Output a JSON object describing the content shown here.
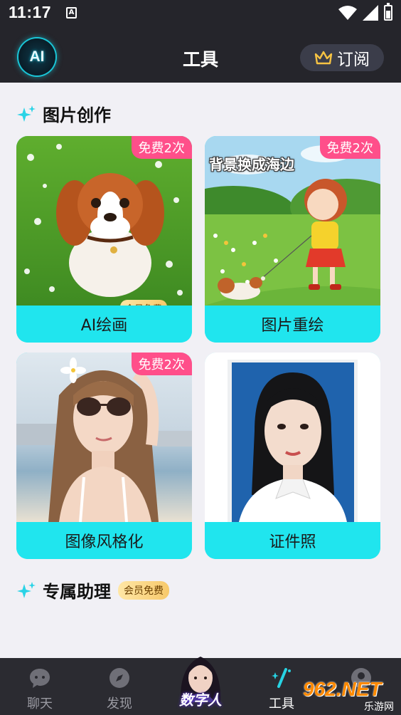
{
  "status_bar": {
    "time": "11:17",
    "notification_icon": "A"
  },
  "header": {
    "title": "工具",
    "subscribe_label": "订阅",
    "logo_text": "AI"
  },
  "sections": {
    "image_creation": {
      "title": "图片创作"
    },
    "assistant": {
      "title": "专属助理",
      "badge": "会员免费"
    }
  },
  "cards": [
    {
      "label": "AI绘画",
      "badge": "免费2次",
      "member_badge": "会员免费"
    },
    {
      "label": "图片重绘",
      "badge": "免费2次",
      "overlay": "背景换成海边"
    },
    {
      "label": "图像风格化",
      "badge": "免费2次"
    },
    {
      "label": "证件照"
    }
  ],
  "bottom_nav": {
    "items": [
      {
        "label": "聊天",
        "icon": "chat-icon"
      },
      {
        "label": "发现",
        "icon": "compass-icon"
      },
      {
        "label": "数字人",
        "icon": "digital-human-avatar"
      },
      {
        "label": "工具",
        "icon": "tools-icon",
        "active": true
      },
      {
        "label": "",
        "icon": "profile-icon"
      }
    ]
  },
  "watermark": {
    "main": "962.NET",
    "sub": "乐游网"
  },
  "colors": {
    "header_bg": "#25252b",
    "card_label_bg": "#20e5ee",
    "free_badge": "#ff4f8a",
    "member_badge": "#f7c96b",
    "nav_bg": "#2b2b31"
  }
}
